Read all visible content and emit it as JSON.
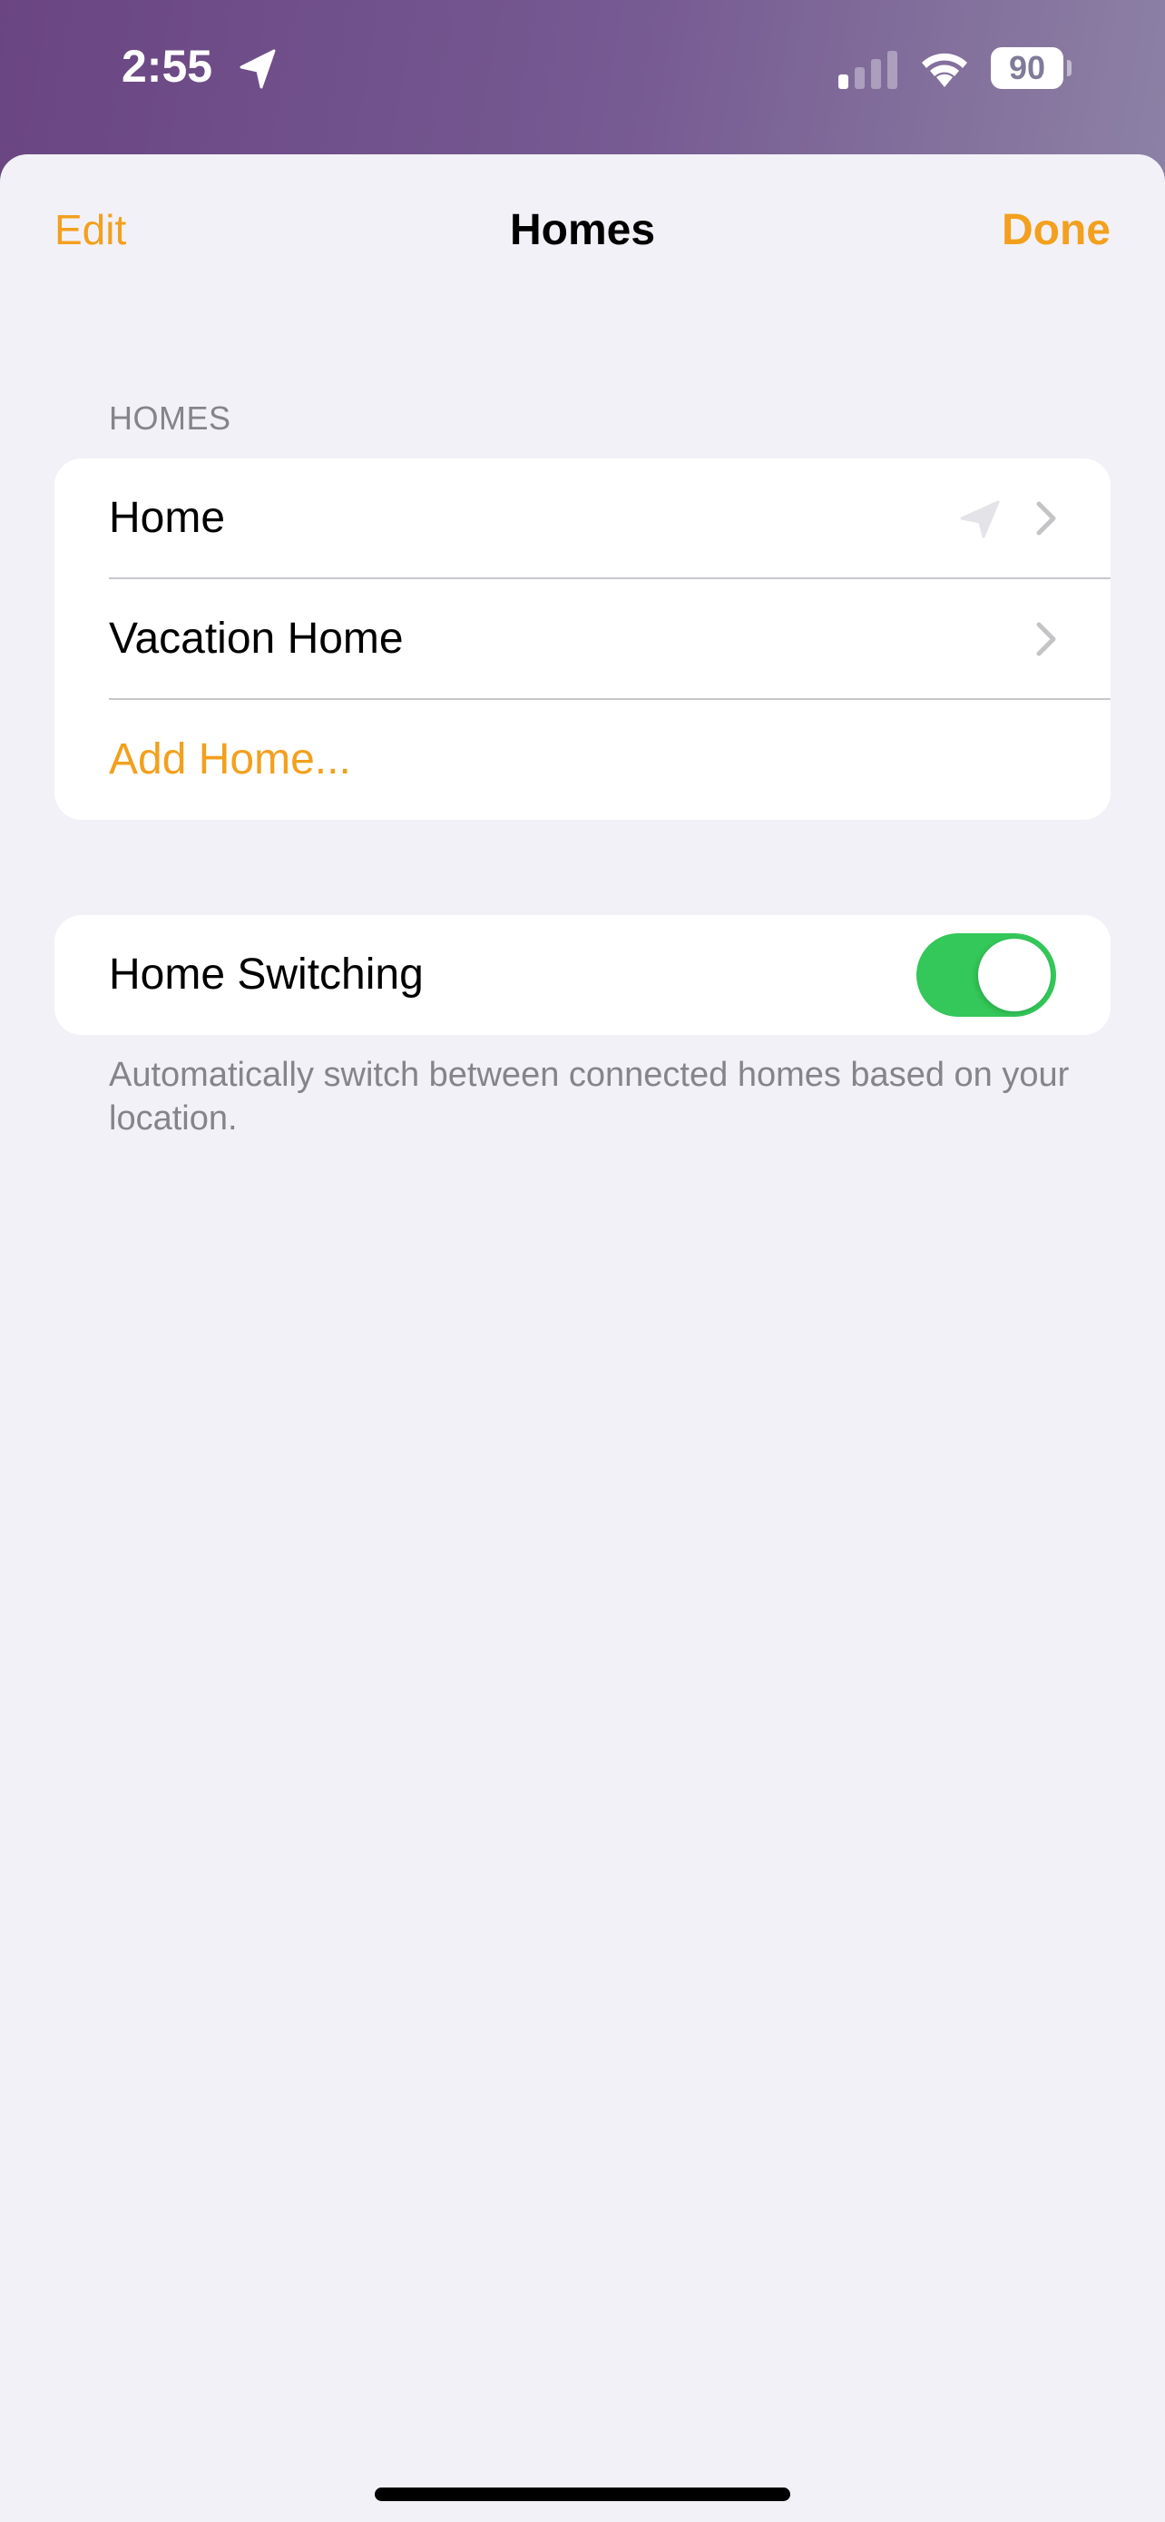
{
  "status_bar": {
    "time": "2:55",
    "location_icon": "location-arrow-icon",
    "signal_icon": "cellular-signal-icon",
    "signal_bars_active": 1,
    "signal_bars_total": 4,
    "wifi_icon": "wifi-icon",
    "battery_level": "90"
  },
  "nav": {
    "edit_label": "Edit",
    "title": "Homes",
    "done_label": "Done"
  },
  "homes_section": {
    "header": "HOMES",
    "items": [
      {
        "label": "Home",
        "current_location": true,
        "icon": "chevron-right-icon"
      },
      {
        "label": "Vacation Home",
        "current_location": false,
        "icon": "chevron-right-icon"
      }
    ],
    "add_label": "Add Home..."
  },
  "home_switching": {
    "label": "Home Switching",
    "enabled": true,
    "footer": "Automatically switch between connected homes based on your location."
  },
  "colors": {
    "accent": "#f2a01e",
    "toggle_on": "#34c759",
    "secondary_text": "#85848a",
    "background": "#f2f1f7"
  }
}
